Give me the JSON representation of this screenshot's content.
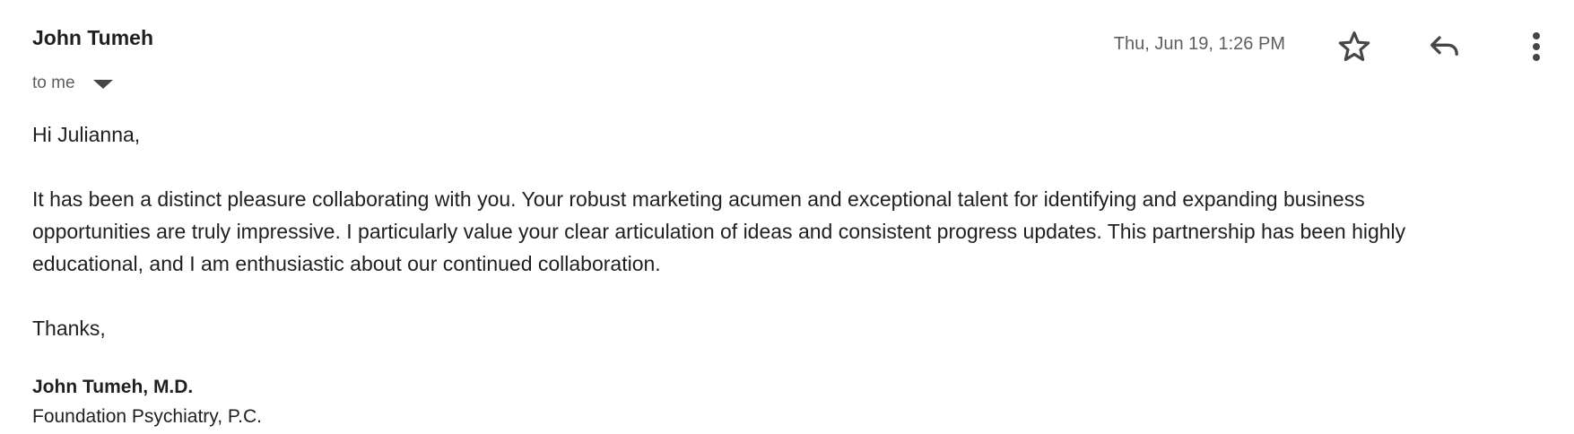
{
  "header": {
    "sender_name": "John Tumeh",
    "recipient_label": "to me",
    "timestamp": "Thu, Jun 19, 1:26 PM",
    "icons": {
      "caret": "chevron-down-icon",
      "star": "star-icon",
      "reply": "reply-icon",
      "more": "more-vert-icon"
    }
  },
  "body": {
    "greeting": "Hi Julianna,",
    "paragraph_lines": [
      "It has been a distinct pleasure collaborating with you. Your robust marketing acumen and exceptional talent for identifying and expanding business",
      "opportunities are truly impressive. I particularly value your clear articulation of ideas and consistent progress updates. This partnership has been highly",
      "educational, and I am enthusiastic about our continued collaboration."
    ],
    "closing": "Thanks,"
  },
  "signature": {
    "name": "John Tumeh, M.D.",
    "organization": "Foundation Psychiatry, P.C."
  },
  "colors": {
    "text": "#1f1f1f",
    "secondary_text": "#5e5e5e",
    "icon": "#444746"
  }
}
